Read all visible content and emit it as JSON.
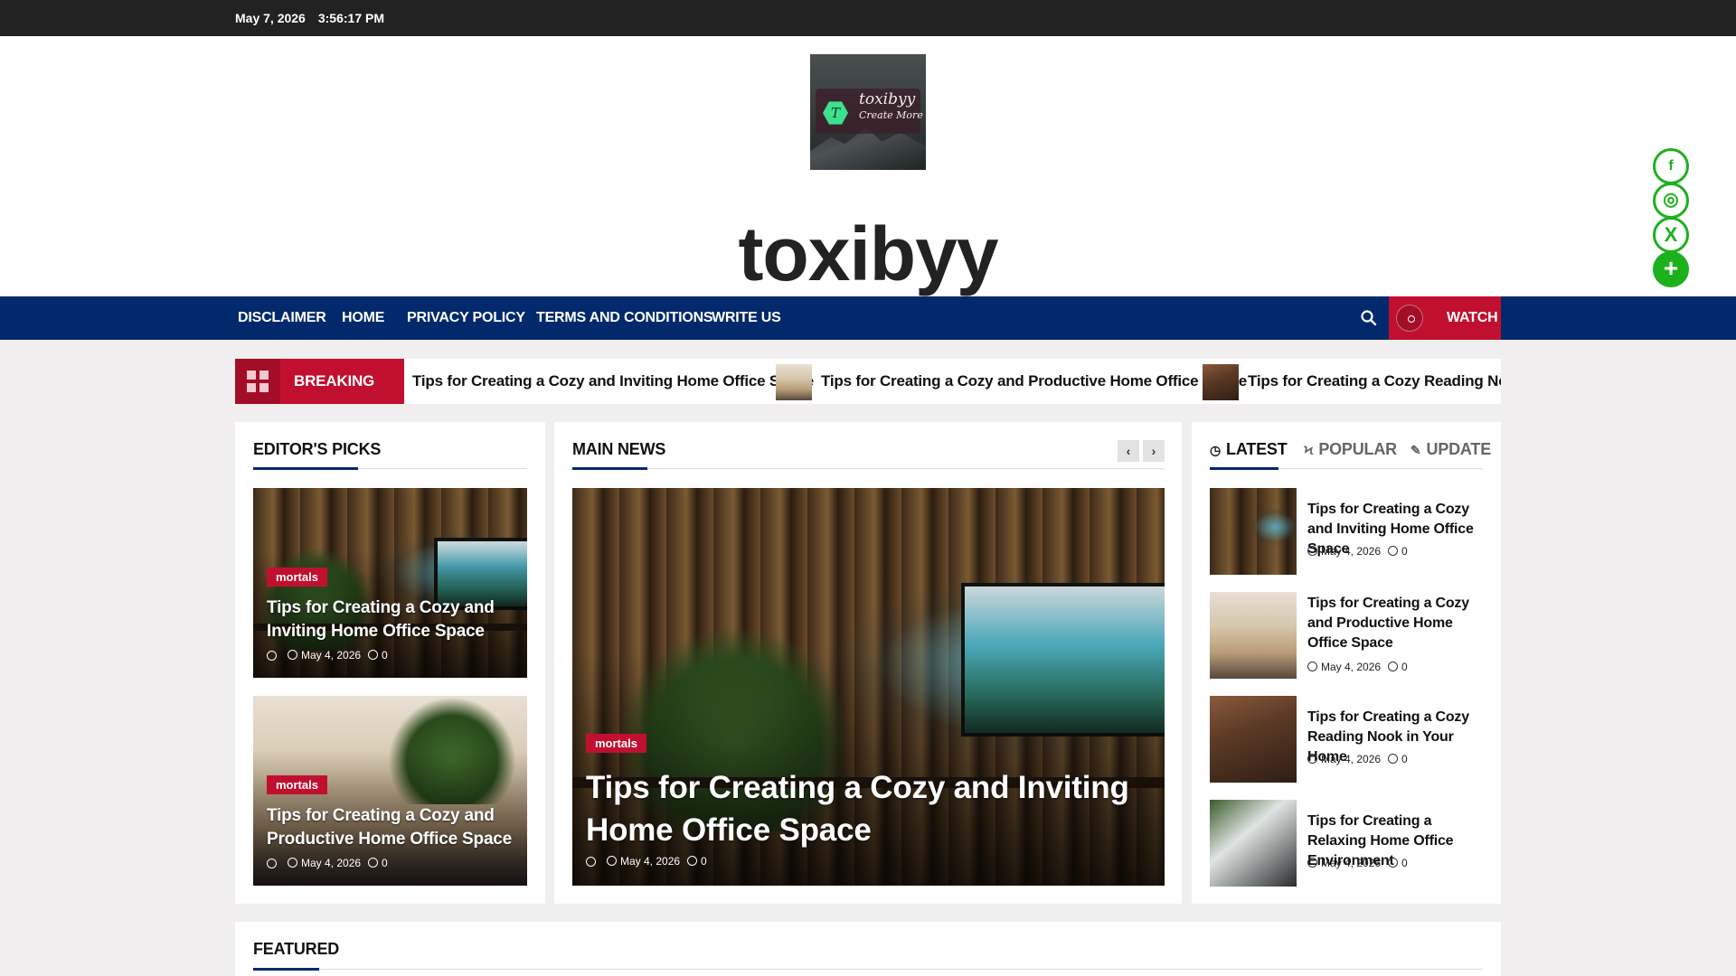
{
  "topbar": {
    "date": "May 7, 2026",
    "time": "3:56:17 PM"
  },
  "header": {
    "logo_text": "toxibyy",
    "logo_tagline": "Create More",
    "logo_letter": "T",
    "site_title": "toxibyy"
  },
  "social": {
    "facebook": "f",
    "instagram": "◎",
    "x": "X",
    "share": "+",
    "hide": "❯"
  },
  "nav": {
    "items": [
      "DISCLAIMER",
      "HOME",
      "PRIVACY POLICY",
      "TERMS AND CONDITIONS",
      "WRITE US"
    ],
    "watch_label": "WATCH"
  },
  "breaking": {
    "label": "BREAKING NEWS",
    "items": [
      "Tips for Creating a Cozy and Inviting Home Office Space",
      "Tips for Creating a Cozy and Productive Home Office Space",
      "Tips for Creating a Cozy Reading Nook in"
    ]
  },
  "editors_picks": {
    "title": "EDITOR'S PICKS",
    "cards": [
      {
        "category": "mortals",
        "title": "Tips for Creating a Cozy and Inviting Home Office Space",
        "date": "May 4, 2026",
        "comments": "0"
      },
      {
        "category": "mortals",
        "title": "Tips for Creating a Cozy and Productive Home Office Space",
        "date": "May 4, 2026",
        "comments": "0"
      }
    ]
  },
  "main_news": {
    "title": "MAIN NEWS",
    "prev": "‹",
    "next": "›",
    "feature": {
      "category": "mortals",
      "title": "Tips for Creating a Cozy and Inviting Home Office Space",
      "date": "May 4, 2026",
      "comments": "0"
    }
  },
  "sidebar_tabs": {
    "tabs": [
      "LATEST",
      "POPULAR",
      "UPDATE"
    ],
    "active": "LATEST",
    "items": [
      {
        "title": "Tips for Creating a Cozy and Inviting Home Office Space",
        "date": "May 4, 2026",
        "comments": "0"
      },
      {
        "title": "Tips for Creating a Cozy and Productive Home Office Space",
        "date": "May 4, 2026",
        "comments": "0"
      },
      {
        "title": "Tips for Creating a Cozy Reading Nook in Your Home",
        "date": "May 4, 2026",
        "comments": "0"
      },
      {
        "title": "Tips for Creating a Relaxing Home Office Environment",
        "date": "May 4, 2026",
        "comments": "0"
      }
    ]
  },
  "featured": {
    "title": "FEATURED"
  },
  "colors": {
    "accent": "#c1102f",
    "nav": "#01296b",
    "topbar": "#222222",
    "social": "#1db01d"
  }
}
